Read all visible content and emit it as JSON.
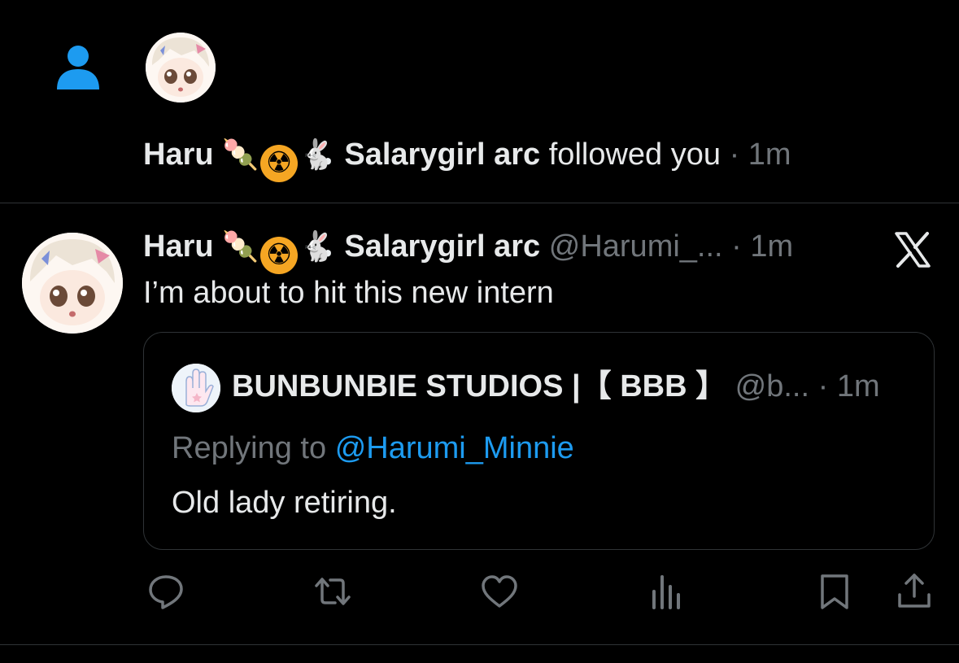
{
  "follow_notification": {
    "user_name": "Haru",
    "user_suffix": "Salarygirl arc",
    "emojis": [
      "🍡",
      "☢",
      "🐇"
    ],
    "action_text": "followed you",
    "separator": "·",
    "time": "1m"
  },
  "tweet": {
    "user_name": "Haru",
    "user_suffix": "Salarygirl arc",
    "emojis": [
      "🍡",
      "☢",
      "🐇"
    ],
    "handle": "@Harumi_...",
    "separator": "·",
    "time": "1m",
    "text": "I’m about to hit this new intern",
    "quote": {
      "author": "BUNBUNBIE STUDIOS |【 BBB 】",
      "handle": "@b...",
      "separator": "·",
      "time": "1m",
      "replying_prefix": "Replying to",
      "replying_handle": "@Harumi_Minnie",
      "text": "Old lady retiring."
    }
  },
  "actions": [
    "reply-icon",
    "retweet-icon",
    "like-icon",
    "views-icon",
    "bookmark-icon",
    "share-icon"
  ],
  "colors": {
    "background": "#000000",
    "text": "#e7e9ea",
    "muted": "#71767b",
    "accent": "#1d9bf0",
    "divider": "#2f3336"
  }
}
